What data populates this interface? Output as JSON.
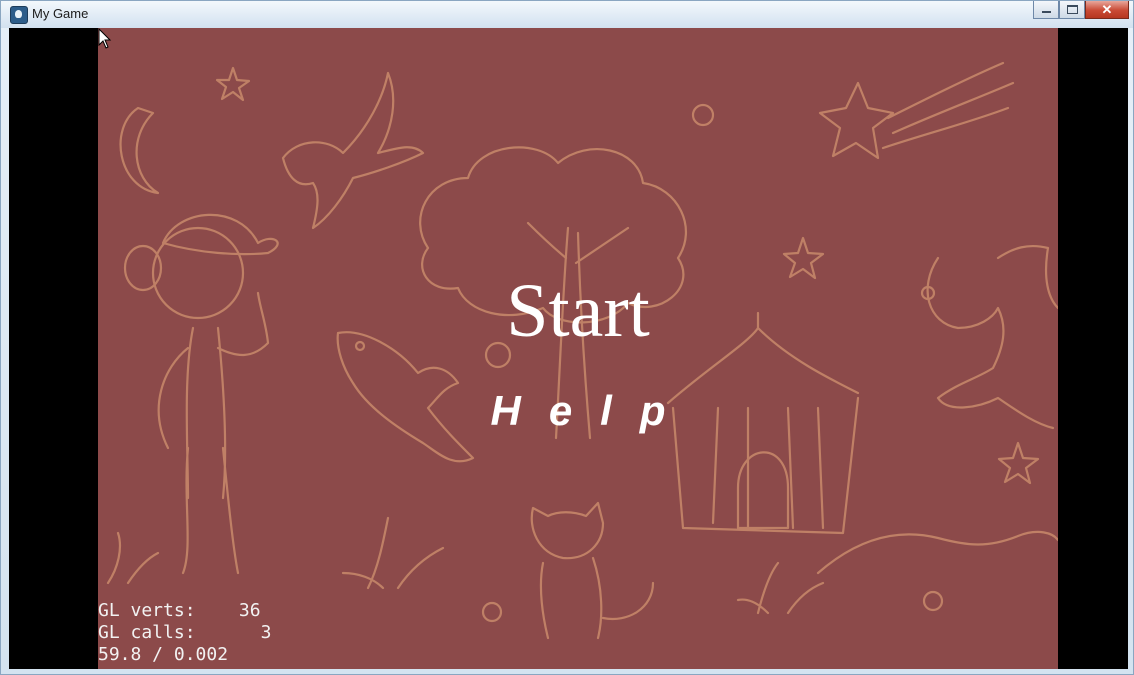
{
  "window": {
    "title": "My Game"
  },
  "menu": {
    "start_label": "Start",
    "help_label": "Help"
  },
  "stats": {
    "verts_label": "GL verts:",
    "verts_value": "36",
    "calls_label": "GL calls:",
    "calls_value": "3",
    "fps_line": "59.8 / 0.002"
  },
  "colors": {
    "background": "#8c4a4a",
    "sketch": "#c98a6b",
    "text": "#ffffff"
  }
}
